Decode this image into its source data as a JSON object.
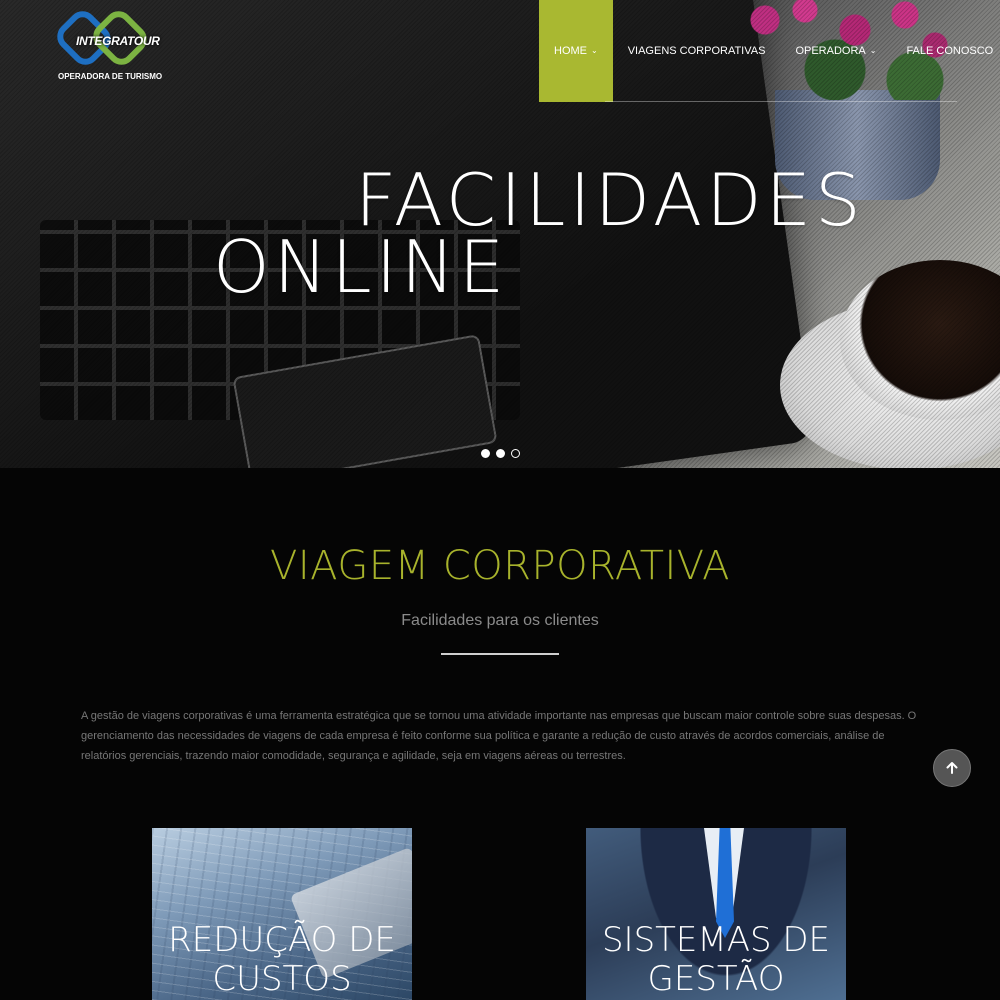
{
  "brand": {
    "name": "INTEGRATOUR",
    "tagline": "OPERADORA DE TURISMO"
  },
  "nav": {
    "items": [
      {
        "label": "HOME",
        "has_dropdown": true,
        "active": true
      },
      {
        "label": "VIAGENS CORPORATIVAS",
        "has_dropdown": false,
        "active": false
      },
      {
        "label": "OPERADORA",
        "has_dropdown": true,
        "active": false
      },
      {
        "label": "FALE CONOSCO",
        "has_dropdown": false,
        "active": false
      }
    ],
    "chevron": "⌄"
  },
  "hero": {
    "line1": "FACILIDADES",
    "line2": "ONLINE",
    "slides_total": 3,
    "active_slide": 3
  },
  "section": {
    "title": "VIAGEM CORPORATIVA",
    "subtitle": "Facilidades para os clientes",
    "body": "A gestão de viagens corporativas é uma ferramenta estratégica que se tornou uma atividade importante nas empresas que buscam maior controle sobre suas despesas. O gerenciamento das necessidades de viagens de cada empresa é feito conforme sua política e garante a redução de custo através de acordos comerciais, análise de relatórios gerenciais, trazendo maior comodidade, segurança e agilidade, seja em viagens aéreas ou terrestres."
  },
  "cards": [
    {
      "line1": "REDUÇÃO DE",
      "line2": "CUSTOS"
    },
    {
      "line1": "SISTEMAS DE",
      "line2": "GESTÃO"
    }
  ],
  "colors": {
    "accent": "#a9b831",
    "section_title": "#a8b32c",
    "background": "#050505"
  },
  "icons": {
    "scroll_top": "arrow-up-icon"
  }
}
